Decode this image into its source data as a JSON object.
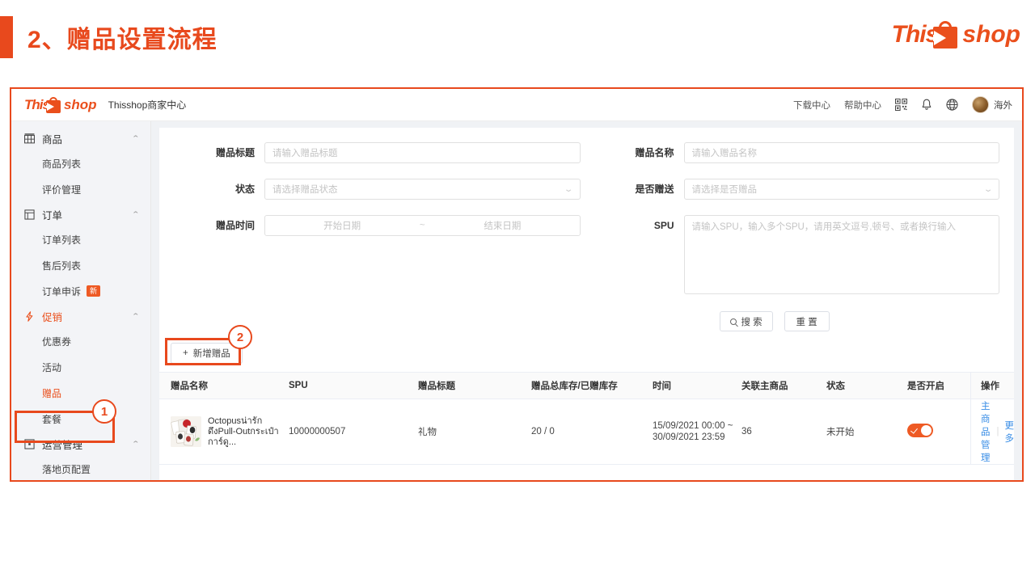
{
  "slide": {
    "title": "2、赠品设置流程",
    "accent_color": "#e8491d"
  },
  "brand": {
    "logo_part1": "This",
    "logo_part2": "shop",
    "logo_icon": "shopping-bag-arrow-icon"
  },
  "app": {
    "brand_subtitle": "Thisshop商家中心",
    "topbar": {
      "download_center": "下载中心",
      "help_center": "帮助中心",
      "qr_icon": "qr-code-icon",
      "bell_icon": "bell-icon",
      "globe_icon": "globe-icon",
      "avatar_label": "海外"
    },
    "sidebar": {
      "groups": [
        {
          "label": "商品",
          "icon": "goods-icon",
          "expanded": true,
          "caret": "⌃",
          "items": [
            {
              "label": "商品列表",
              "badge": ""
            },
            {
              "label": "评价管理",
              "badge": ""
            }
          ]
        },
        {
          "label": "订单",
          "icon": "order-icon",
          "expanded": true,
          "caret": "⌃",
          "items": [
            {
              "label": "订单列表",
              "badge": ""
            },
            {
              "label": "售后列表",
              "badge": ""
            },
            {
              "label": "订单申诉",
              "badge": "新"
            }
          ]
        },
        {
          "label": "促销",
          "icon": "promotion-bolt-icon",
          "expanded": true,
          "active": true,
          "caret": "⌃",
          "items": [
            {
              "label": "优惠券",
              "badge": ""
            },
            {
              "label": "活动",
              "badge": ""
            },
            {
              "label": "赠品",
              "badge": "",
              "current": true
            },
            {
              "label": "套餐",
              "badge": ""
            }
          ]
        },
        {
          "label": "运营管理",
          "icon": "operations-icon",
          "expanded": true,
          "caret": "⌃",
          "items": [
            {
              "label": "落地页配置",
              "badge": ""
            }
          ]
        }
      ]
    },
    "search_form": {
      "left": [
        {
          "label": "赠品标题",
          "type": "text",
          "value": "",
          "placeholder": "请输入赠品标题"
        },
        {
          "label": "状态",
          "type": "select",
          "value": "",
          "placeholder": "请选择赠品状态"
        },
        {
          "label": "赠品时间",
          "type": "daterange",
          "value": "",
          "placeholder_start": "开始日期",
          "separator": "~",
          "placeholder_end": "结束日期"
        }
      ],
      "right": [
        {
          "label": "赠品名称",
          "type": "text",
          "value": "",
          "placeholder": "请输入赠品名称"
        },
        {
          "label": "是否赠送",
          "type": "select",
          "value": "",
          "placeholder": "请选择是否赠品"
        },
        {
          "label": "SPU",
          "type": "textarea",
          "value": "",
          "placeholder": "请输入SPU，输入多个SPU，请用英文逗号,顿号、或者换行输入"
        }
      ],
      "search_button": "搜 索",
      "reset_button": "重 置"
    },
    "toolbar": {
      "add_button": "新增赠品",
      "add_icon": "plus-icon"
    },
    "table": {
      "columns": [
        "赠品名称",
        "SPU",
        "赠品标题",
        "赠品总库存/已赠库存",
        "时间",
        "关联主商品",
        "状态",
        "是否开启",
        "操作"
      ],
      "rows": [
        {
          "thumb": "product-thumbnail",
          "name": "Octopusน่ารักดึงPull-Outกระเป๋าการ์ดู...",
          "spu": "10000000507",
          "title": "礼物",
          "stock": "20 / 0",
          "time": "15/09/2021 00:00 ~ 30/09/2021 23:59",
          "related_main_goods": "36",
          "status": "未开始",
          "enabled": true,
          "actions": [
            {
              "label": "主商品管理"
            },
            {
              "label": "更多"
            }
          ]
        }
      ]
    },
    "annotations": [
      {
        "number": "1",
        "target": "sidebar-item-gift"
      },
      {
        "number": "2",
        "target": "add-gift-button"
      }
    ]
  }
}
